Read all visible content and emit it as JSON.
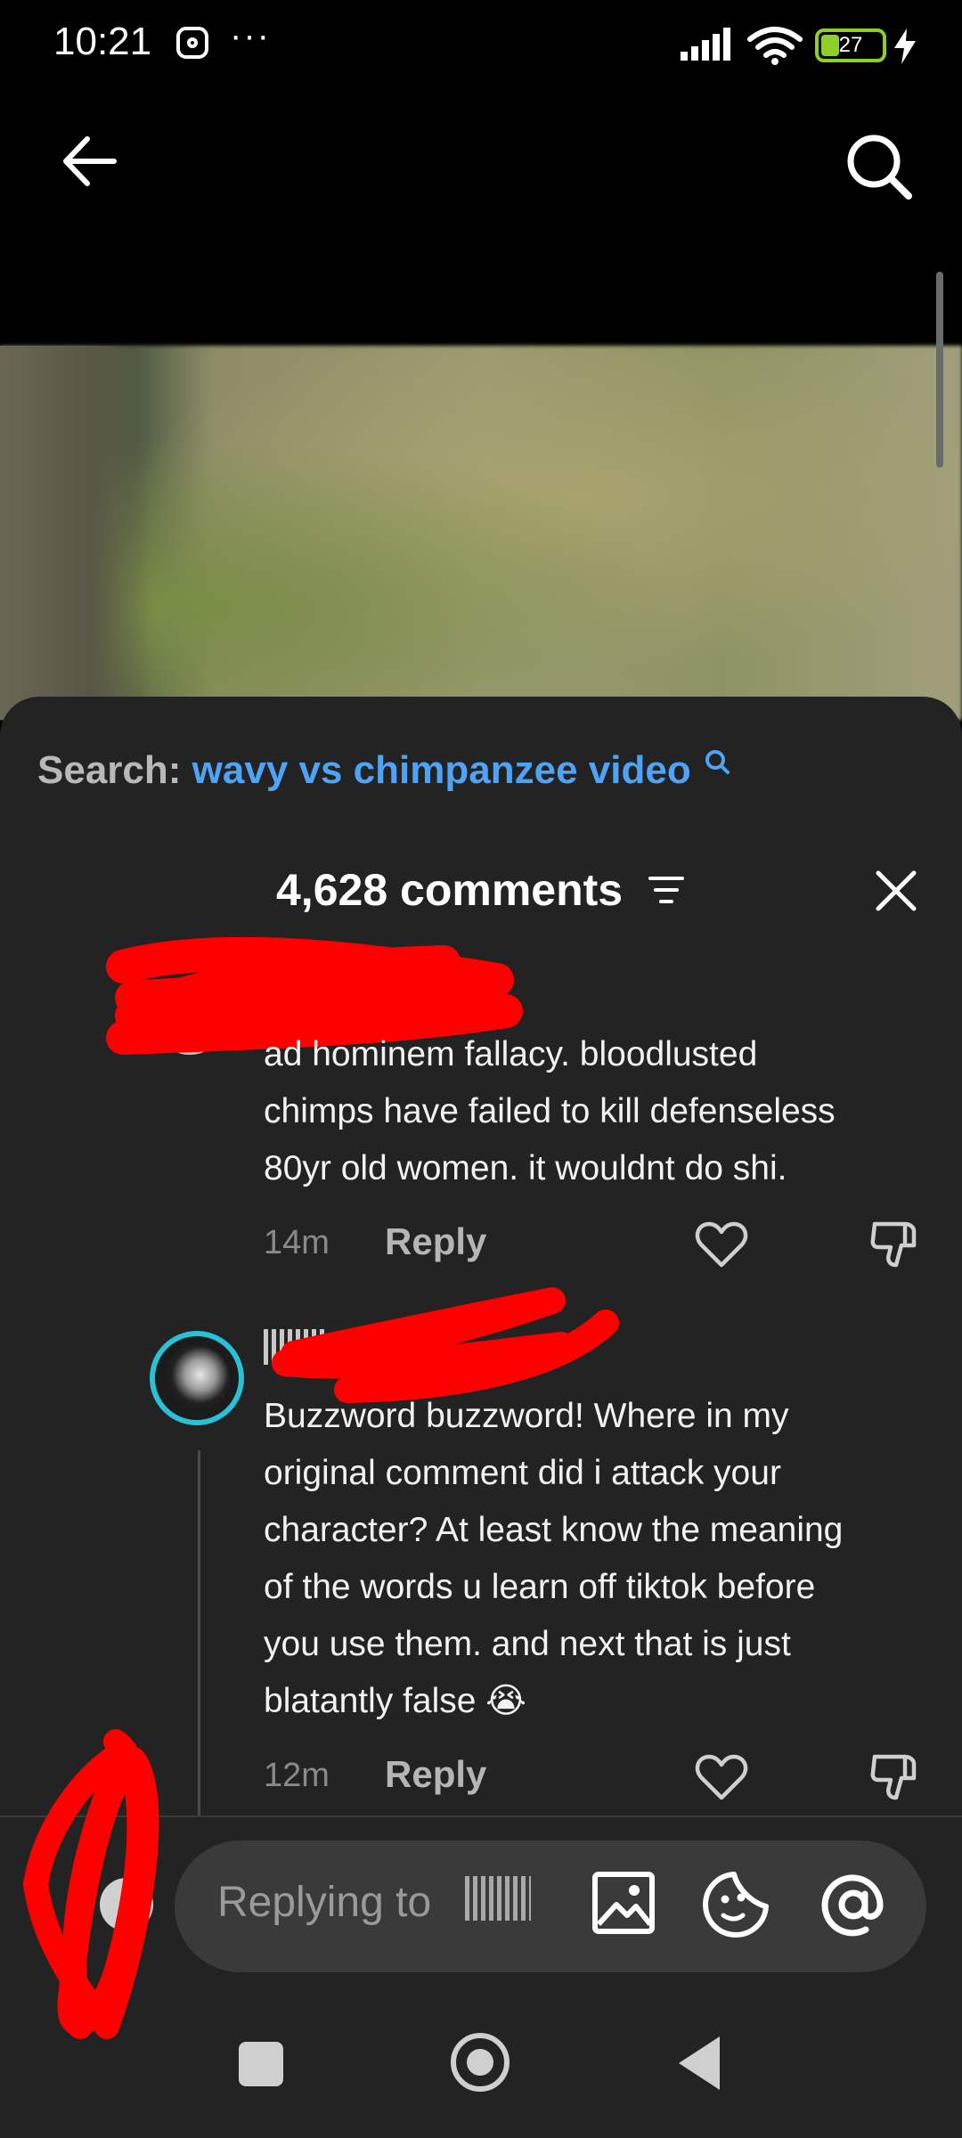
{
  "status_bar": {
    "time": "10:21",
    "overflow": "···",
    "battery": "27",
    "icons": [
      "instagram-icon",
      "signal-icon",
      "wifi-icon",
      "battery-icon",
      "charging-icon"
    ]
  },
  "header": {
    "icons": [
      "back-arrow-icon",
      "search-icon"
    ]
  },
  "search_suggestion": {
    "label": "Search:",
    "query": "wavy vs chimpanzee video"
  },
  "comments_panel": {
    "title": "4,628 comments",
    "icons": [
      "sort-filter-icon",
      "close-icon"
    ],
    "comments": [
      {
        "text_lines": [
          "ad hominem fallacy. bloodlusted",
          "chimps have failed to kill defenseless",
          "80yr old women. it wouldnt do shi."
        ],
        "time": "14m",
        "reply_label": "Reply"
      },
      {
        "text_lines": [
          "Buzzword buzzword! Where in my",
          "original comment did i attack your",
          "character? At least know the meaning",
          "of the words u learn off tiktok before",
          "you use them. and next that is just",
          "blatantly false 😭"
        ],
        "time": "12m",
        "reply_label": "Reply"
      }
    ]
  },
  "composer": {
    "placeholder": "Replying to",
    "icons": [
      "image-icon",
      "sticker-icon",
      "mention-at-icon"
    ]
  },
  "system_nav": {
    "icons": [
      "recents-square-icon",
      "home-circle-icon",
      "back-triangle-icon"
    ]
  },
  "colors": {
    "background": "#000000",
    "sheet": "#232323",
    "accent_link": "#4fa3f7",
    "avatar_ring": "#2ac0d6",
    "battery": "#8ccf2b",
    "redaction": "#ff0000"
  }
}
